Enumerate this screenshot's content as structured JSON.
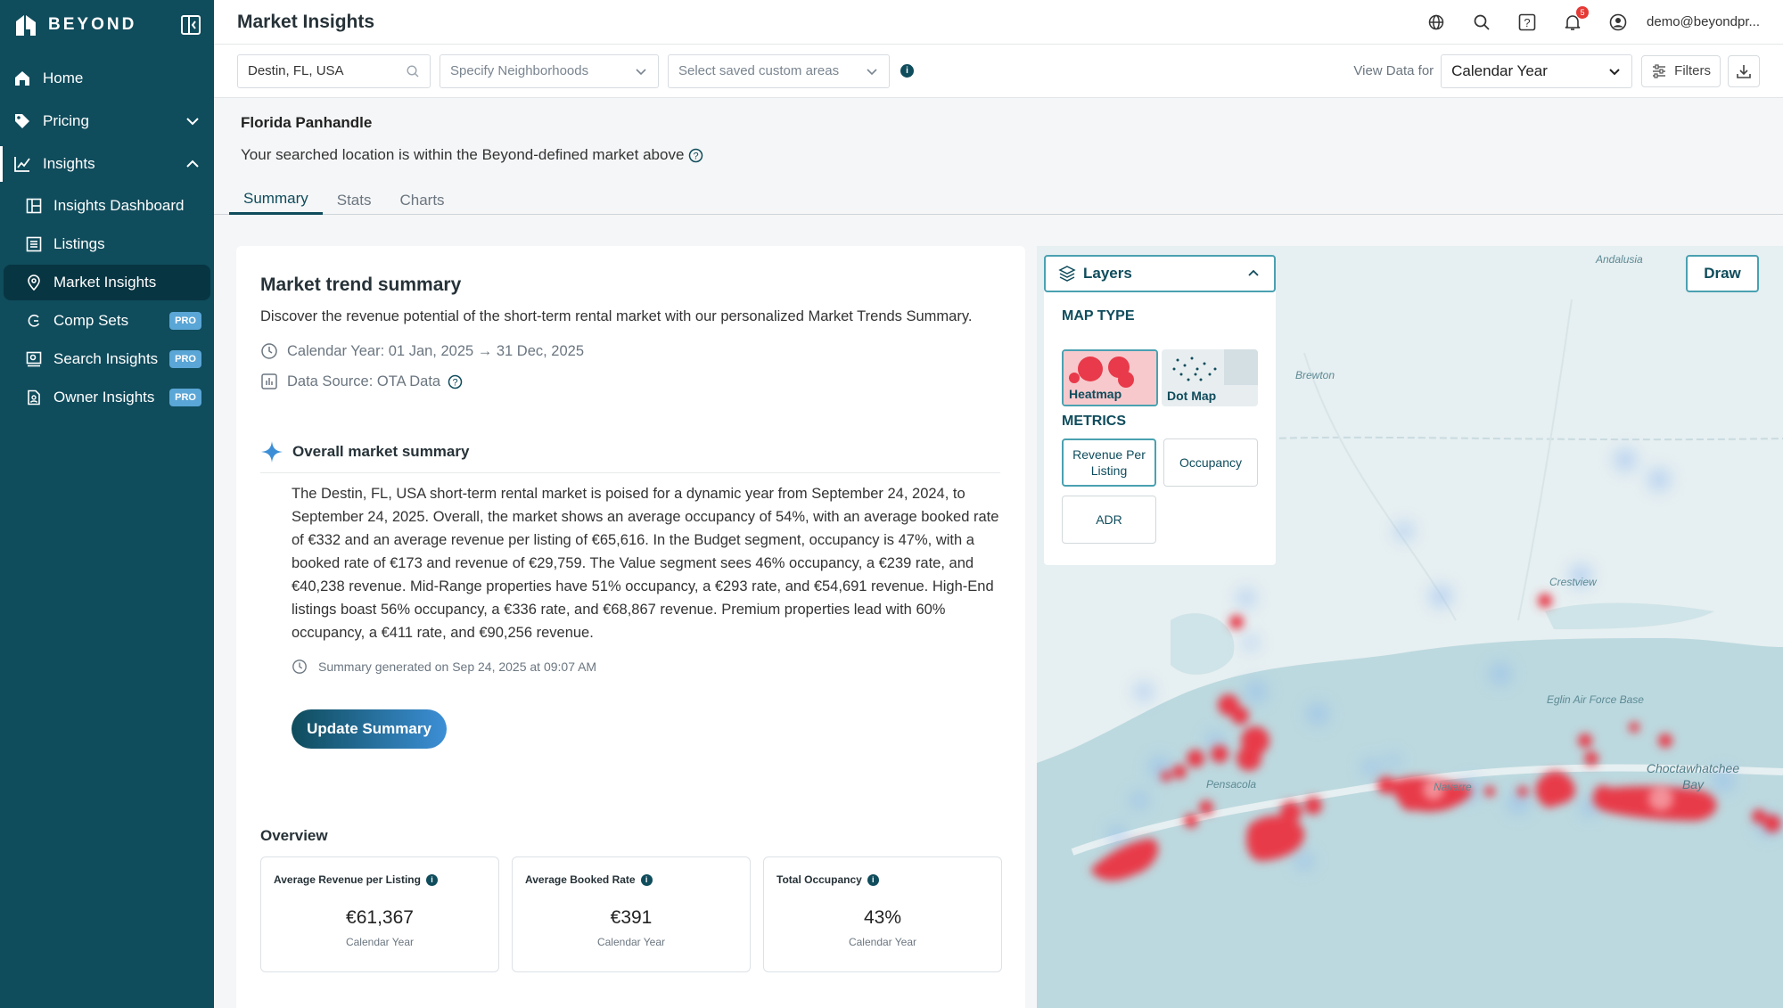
{
  "brand": {
    "name": "BEYOND"
  },
  "sidebar": {
    "items": [
      {
        "label": "Home"
      },
      {
        "label": "Pricing"
      },
      {
        "label": "Insights"
      }
    ],
    "sub_items": [
      {
        "label": "Insights Dashboard"
      },
      {
        "label": "Listings"
      },
      {
        "label": "Market Insights"
      },
      {
        "label": "Comp Sets",
        "badge": "PRO"
      },
      {
        "label": "Search Insights",
        "badge": "PRO"
      },
      {
        "label": "Owner Insights",
        "badge": "PRO"
      }
    ]
  },
  "header": {
    "title": "Market Insights",
    "notification_count": "5",
    "user_email": "demo@beyondpr..."
  },
  "filters": {
    "location_value": "Destin, FL, USA",
    "neighborhoods_placeholder": "Specify Neighborhoods",
    "areas_placeholder": "Select saved custom areas",
    "view_label": "View Data for",
    "period_value": "Calendar Year",
    "filters_label": "Filters"
  },
  "market": {
    "name": "Florida Panhandle",
    "note": "Your searched location is within the Beyond-defined market above"
  },
  "tabs": [
    {
      "label": "Summary",
      "active": true
    },
    {
      "label": "Stats"
    },
    {
      "label": "Charts"
    }
  ],
  "summary": {
    "title": "Market trend summary",
    "description": "Discover the revenue potential of the short-term rental market with our personalized Market Trends Summary.",
    "period": "Calendar Year: 01 Jan, 2025 → 31 Dec, 2025",
    "source": "Data Source: OTA Data",
    "overall_title": "Overall market summary",
    "text": "The Destin, FL, USA short-term rental market is poised for a dynamic year from September 24, 2024, to September 24, 2025. Overall, the market shows an average occupancy of 54%, with an average booked rate of €332 and an average revenue per listing of €65,616. In the Budget segment, occupancy is 47%, with a booked rate of €173 and revenue of €29,759. The Value segment sees 46% occupancy, a €239 rate, and €40,238 revenue. Mid-Range properties have 51% occupancy, a €293 rate, and €54,691 revenue. High-End listings boast 56% occupancy, a €336 rate, and €68,867 revenue. Premium properties lead with 60% occupancy, a €411 rate, and €90,256 revenue.",
    "generated": "Summary generated on Sep 24, 2025 at 09:07 AM",
    "update_button": "Update Summary"
  },
  "overview": {
    "title": "Overview",
    "kpis": [
      {
        "label": "Average Revenue per Listing",
        "value": "€61,367",
        "sub": "Calendar Year"
      },
      {
        "label": "Average Booked Rate",
        "value": "€391",
        "sub": "Calendar Year"
      },
      {
        "label": "Total Occupancy",
        "value": "43%",
        "sub": "Calendar Year"
      }
    ]
  },
  "map": {
    "layers_label": "Layers",
    "map_type_label": "MAP TYPE",
    "map_types": [
      {
        "label": "Heatmap",
        "selected": true
      },
      {
        "label": "Dot Map"
      }
    ],
    "metrics_label": "METRICS",
    "metrics": [
      {
        "label": "Revenue Per Listing",
        "selected": true
      },
      {
        "label": "Occupancy"
      },
      {
        "label": "ADR"
      }
    ],
    "draw_button": "Draw",
    "place_labels": [
      "Andalusia",
      "Brewton",
      "Crestview",
      "Eglin Air Force Base",
      "Choctawhatchee Bay",
      "Pensacola",
      "Navarre"
    ]
  },
  "colors": {
    "sidebar_bg": "#0f4c5c",
    "accent": "#4aa1b1",
    "heat": "#e83a4a",
    "badge": "#e53935"
  }
}
